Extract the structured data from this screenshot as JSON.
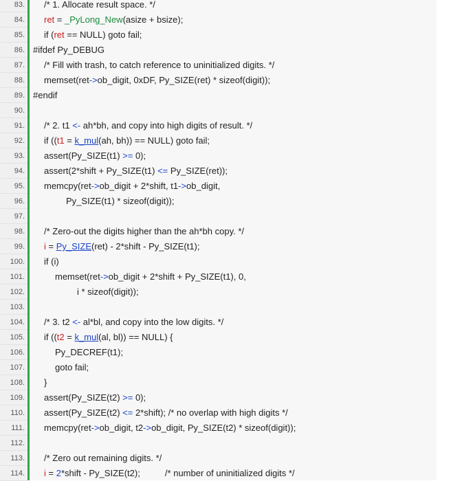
{
  "lines": [
    {
      "n": "83.",
      "indent": 1,
      "tokens": [
        {
          "t": "/* 1. Allocate result space. */",
          "c": ""
        }
      ]
    },
    {
      "n": "84.",
      "indent": 1,
      "tokens": [
        {
          "t": "ret",
          "c": "red"
        },
        {
          "t": " = ",
          "c": ""
        },
        {
          "t": "_PyLong_New",
          "c": "fn"
        },
        {
          "t": "(asize + bsize);",
          "c": ""
        }
      ]
    },
    {
      "n": "85.",
      "indent": 1,
      "tokens": [
        {
          "t": "if (",
          "c": ""
        },
        {
          "t": "ret",
          "c": "red"
        },
        {
          "t": " == NULL) goto fail;",
          "c": ""
        }
      ]
    },
    {
      "n": "86.",
      "indent": 0,
      "tokens": [
        {
          "t": "#ifdef Py_DEBUG",
          "c": ""
        }
      ]
    },
    {
      "n": "87.",
      "indent": 1,
      "tokens": [
        {
          "t": "/* Fill with trash, to catch reference to uninitialized digits. */",
          "c": ""
        }
      ]
    },
    {
      "n": "88.",
      "indent": 1,
      "tokens": [
        {
          "t": "memset(ret",
          "c": ""
        },
        {
          "t": "->",
          "c": "op"
        },
        {
          "t": "ob_digit, 0xDF, Py_SIZE(ret) * sizeof(digit));",
          "c": ""
        }
      ]
    },
    {
      "n": "89.",
      "indent": 0,
      "tokens": [
        {
          "t": "#endif",
          "c": ""
        }
      ]
    },
    {
      "n": "90.",
      "indent": 0,
      "tokens": []
    },
    {
      "n": "91.",
      "indent": 1,
      "tokens": [
        {
          "t": "/* 2. t1 ",
          "c": ""
        },
        {
          "t": "<-",
          "c": "op"
        },
        {
          "t": " ah*bh, and copy into high digits of result. */",
          "c": ""
        }
      ]
    },
    {
      "n": "92.",
      "indent": 1,
      "tokens": [
        {
          "t": "if ((",
          "c": ""
        },
        {
          "t": "t1",
          "c": "red"
        },
        {
          "t": " = ",
          "c": ""
        },
        {
          "t": "k_mul",
          "c": "link"
        },
        {
          "t": "(ah, bh)) == NULL) goto fail;",
          "c": ""
        }
      ]
    },
    {
      "n": "93.",
      "indent": 1,
      "tokens": [
        {
          "t": "assert(Py_SIZE(t1) ",
          "c": ""
        },
        {
          "t": ">=",
          "c": "op"
        },
        {
          "t": " 0);",
          "c": ""
        }
      ]
    },
    {
      "n": "94.",
      "indent": 1,
      "tokens": [
        {
          "t": "assert(2*shift + Py_SIZE(t1) ",
          "c": ""
        },
        {
          "t": "<=",
          "c": "op"
        },
        {
          "t": " Py_SIZE(ret));",
          "c": ""
        }
      ]
    },
    {
      "n": "95.",
      "indent": 1,
      "tokens": [
        {
          "t": "memcpy(ret",
          "c": ""
        },
        {
          "t": "->",
          "c": "op"
        },
        {
          "t": "ob_digit + 2*shift, t1",
          "c": ""
        },
        {
          "t": "->",
          "c": "op"
        },
        {
          "t": "ob_digit,",
          "c": ""
        }
      ]
    },
    {
      "n": "96.",
      "indent": 3,
      "tokens": [
        {
          "t": "Py_SIZE(t1) * sizeof(digit));",
          "c": ""
        }
      ]
    },
    {
      "n": "97.",
      "indent": 0,
      "tokens": []
    },
    {
      "n": "98.",
      "indent": 1,
      "tokens": [
        {
          "t": "/* Zero-out the digits higher than the ah*bh copy. */",
          "c": ""
        }
      ]
    },
    {
      "n": "99.",
      "indent": 1,
      "tokens": [
        {
          "t": "i",
          "c": "red"
        },
        {
          "t": " = ",
          "c": ""
        },
        {
          "t": "Py_SIZE",
          "c": "link"
        },
        {
          "t": "(ret) - 2*shift - Py_SIZE(t1);",
          "c": ""
        }
      ]
    },
    {
      "n": "100.",
      "indent": 1,
      "tokens": [
        {
          "t": "if (i)",
          "c": ""
        }
      ]
    },
    {
      "n": "101.",
      "indent": 2,
      "tokens": [
        {
          "t": "memset(ret",
          "c": ""
        },
        {
          "t": "->",
          "c": "op"
        },
        {
          "t": "ob_digit + 2*shift + Py_SIZE(t1), 0,",
          "c": ""
        }
      ]
    },
    {
      "n": "102.",
      "indent": 4,
      "tokens": [
        {
          "t": "i * sizeof(digit));",
          "c": ""
        }
      ]
    },
    {
      "n": "103.",
      "indent": 0,
      "tokens": []
    },
    {
      "n": "104.",
      "indent": 1,
      "tokens": [
        {
          "t": "/* 3. t2 ",
          "c": ""
        },
        {
          "t": "<-",
          "c": "op"
        },
        {
          "t": " al*bl, and copy into the low digits. */",
          "c": ""
        }
      ]
    },
    {
      "n": "105.",
      "indent": 1,
      "tokens": [
        {
          "t": "if ((",
          "c": ""
        },
        {
          "t": "t2",
          "c": "red"
        },
        {
          "t": " = ",
          "c": ""
        },
        {
          "t": "k_mul",
          "c": "link"
        },
        {
          "t": "(al, bl)) == NULL) {",
          "c": ""
        }
      ]
    },
    {
      "n": "106.",
      "indent": 2,
      "tokens": [
        {
          "t": "Py_DECREF(t1);",
          "c": ""
        }
      ]
    },
    {
      "n": "107.",
      "indent": 2,
      "tokens": [
        {
          "t": "goto fail;",
          "c": ""
        }
      ]
    },
    {
      "n": "108.",
      "indent": 1,
      "tokens": [
        {
          "t": "}",
          "c": ""
        }
      ]
    },
    {
      "n": "109.",
      "indent": 1,
      "tokens": [
        {
          "t": "assert(Py_SIZE(t2) ",
          "c": ""
        },
        {
          "t": ">=",
          "c": "op"
        },
        {
          "t": " 0);",
          "c": ""
        }
      ]
    },
    {
      "n": "110.",
      "indent": 1,
      "tokens": [
        {
          "t": "assert(Py_SIZE(t2) ",
          "c": ""
        },
        {
          "t": "<=",
          "c": "op"
        },
        {
          "t": " 2*shift); /* no overlap with high digits */",
          "c": ""
        }
      ]
    },
    {
      "n": "111.",
      "indent": 1,
      "tokens": [
        {
          "t": "memcpy(ret",
          "c": ""
        },
        {
          "t": "->",
          "c": "op"
        },
        {
          "t": "ob_digit, t2",
          "c": ""
        },
        {
          "t": "->",
          "c": "op"
        },
        {
          "t": "ob_digit, Py_SIZE(t2) * sizeof(digit));",
          "c": ""
        }
      ]
    },
    {
      "n": "112.",
      "indent": 0,
      "tokens": []
    },
    {
      "n": "113.",
      "indent": 1,
      "tokens": [
        {
          "t": "/* Zero out remaining digits. */",
          "c": ""
        }
      ]
    },
    {
      "n": "114.",
      "indent": 1,
      "tokens": [
        {
          "t": "i",
          "c": "red"
        },
        {
          "t": " = ",
          "c": ""
        },
        {
          "t": "2",
          "c": "blue"
        },
        {
          "t": "*shift - Py_SIZE(t2);          /* number of uninitialized digits */",
          "c": ""
        }
      ]
    }
  ],
  "colors": {
    "gutter_bg": "#f0f0f0",
    "gutter_border": "#35a34a",
    "code_bg": "#f7f7f7",
    "text": "#222222",
    "identifier_red": "#cc1f1f",
    "link_blue": "#1a44c9",
    "function_green": "#1a8a3a"
  }
}
